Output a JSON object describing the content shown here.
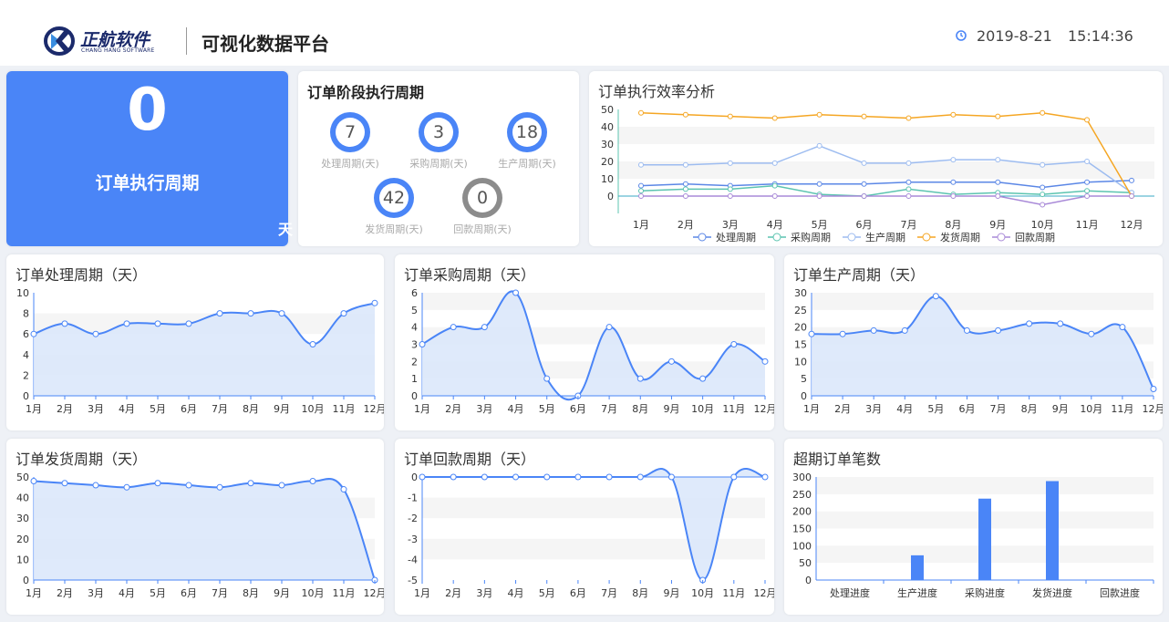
{
  "header": {
    "logo_text": "正航软件",
    "logo_subtext": "CHANG HANG SOFTWARE",
    "app_title": "可视化数据平台",
    "date": "2019-8-21",
    "time": "15:14:36"
  },
  "summary": {
    "value": "0",
    "label": "订单执行周期",
    "unit": "天"
  },
  "stages": {
    "title": "订单阶段执行周期",
    "items": [
      {
        "value": "7",
        "label": "处理周期(天)",
        "color": "#4a85f7"
      },
      {
        "value": "3",
        "label": "采购周期(天)",
        "color": "#4a85f7"
      },
      {
        "value": "18",
        "label": "生产周期(天)",
        "color": "#4a85f7"
      },
      {
        "value": "42",
        "label": "发货周期(天)",
        "color": "#4a85f7"
      },
      {
        "value": "0",
        "label": "回款周期(天)",
        "color": "#8c8c8c"
      }
    ]
  },
  "chart_data": [
    {
      "id": "efficiency",
      "type": "line",
      "title": "订单执行效率分析",
      "categories": [
        "1月",
        "2月",
        "3月",
        "4月",
        "5月",
        "6月",
        "7月",
        "8月",
        "9月",
        "10月",
        "11月",
        "12月"
      ],
      "ylim": [
        -10,
        50
      ],
      "yticks": [
        0,
        10,
        20,
        30,
        40,
        50
      ],
      "legend": "bottom",
      "series": [
        {
          "name": "处理周期",
          "color": "#5b87e6",
          "values": [
            6,
            7,
            6,
            7,
            7,
            7,
            8,
            8,
            8,
            5,
            8,
            9
          ]
        },
        {
          "name": "采购周期",
          "color": "#5cc4b0",
          "values": [
            3,
            4,
            4,
            6,
            1,
            0,
            4,
            1,
            2,
            1,
            3,
            2
          ]
        },
        {
          "name": "生产周期",
          "color": "#9dbcf0",
          "values": [
            18,
            18,
            19,
            19,
            29,
            19,
            19,
            21,
            21,
            18,
            20,
            2
          ]
        },
        {
          "name": "发货周期",
          "color": "#f5a623",
          "values": [
            48,
            47,
            46,
            45,
            47,
            46,
            45,
            47,
            46,
            48,
            44,
            0
          ]
        },
        {
          "name": "回款周期",
          "color": "#a98ad8",
          "values": [
            0,
            0,
            0,
            0,
            0,
            0,
            0,
            0,
            0,
            -5,
            0,
            0
          ]
        }
      ]
    },
    {
      "id": "processing",
      "type": "area",
      "title": "订单处理周期（天）",
      "categories": [
        "1月",
        "2月",
        "3月",
        "4月",
        "5月",
        "6月",
        "7月",
        "8月",
        "9月",
        "10月",
        "11月",
        "12月"
      ],
      "ylim": [
        0,
        10
      ],
      "yticks": [
        0,
        2,
        4,
        6,
        8,
        10
      ],
      "series": [
        {
          "values": [
            6,
            7,
            6,
            7,
            7,
            7,
            8,
            8,
            8,
            5,
            8,
            9
          ]
        }
      ]
    },
    {
      "id": "purchase",
      "type": "area",
      "title": "订单采购周期（天）",
      "categories": [
        "1月",
        "2月",
        "3月",
        "4月",
        "5月",
        "6月",
        "7月",
        "8月",
        "9月",
        "10月",
        "11月",
        "12月"
      ],
      "ylim": [
        0,
        6
      ],
      "yticks": [
        0,
        1,
        2,
        3,
        4,
        5,
        6
      ],
      "series": [
        {
          "values": [
            3,
            4,
            4,
            6,
            1,
            0,
            4,
            1,
            2,
            1,
            3,
            2
          ]
        }
      ]
    },
    {
      "id": "production",
      "type": "area",
      "title": "订单生产周期（天）",
      "categories": [
        "1月",
        "2月",
        "3月",
        "4月",
        "5月",
        "6月",
        "7月",
        "8月",
        "9月",
        "10月",
        "11月",
        "12月"
      ],
      "ylim": [
        0,
        30
      ],
      "yticks": [
        0,
        5,
        10,
        15,
        20,
        25,
        30
      ],
      "series": [
        {
          "values": [
            18,
            18,
            19,
            19,
            29,
            19,
            19,
            21,
            21,
            18,
            20,
            2
          ]
        }
      ]
    },
    {
      "id": "shipping",
      "type": "area",
      "title": "订单发货周期（天）",
      "categories": [
        "1月",
        "2月",
        "3月",
        "4月",
        "5月",
        "6月",
        "7月",
        "8月",
        "9月",
        "10月",
        "11月",
        "12月"
      ],
      "ylim": [
        0,
        50
      ],
      "yticks": [
        0,
        10,
        20,
        30,
        40,
        50
      ],
      "series": [
        {
          "values": [
            48,
            47,
            46,
            45,
            47,
            46,
            45,
            47,
            46,
            48,
            44,
            0
          ]
        }
      ]
    },
    {
      "id": "payment",
      "type": "area",
      "title": "订单回款周期（天）",
      "categories": [
        "1月",
        "2月",
        "3月",
        "4月",
        "5月",
        "6月",
        "7月",
        "8月",
        "9月",
        "10月",
        "11月",
        "12月"
      ],
      "ylim": [
        -5,
        0
      ],
      "yticks": [
        -5,
        -4,
        -3,
        -2,
        -1,
        0
      ],
      "series": [
        {
          "values": [
            0,
            0,
            0,
            0,
            0,
            0,
            0,
            0,
            0,
            -5,
            0,
            0
          ]
        }
      ]
    },
    {
      "id": "overdue",
      "type": "bar",
      "title": "超期订单笔数",
      "categories": [
        "处理进度",
        "生产进度",
        "采购进度",
        "发货进度",
        "回款进度"
      ],
      "ylim": [
        0,
        300
      ],
      "yticks": [
        0,
        50,
        100,
        150,
        200,
        250,
        300
      ],
      "series": [
        {
          "values": [
            0,
            72,
            237,
            288,
            0
          ]
        }
      ]
    }
  ],
  "colors": {
    "accent": "#4a85f7",
    "area_fill": "#dce8fb",
    "band": "#f5f5f5"
  }
}
